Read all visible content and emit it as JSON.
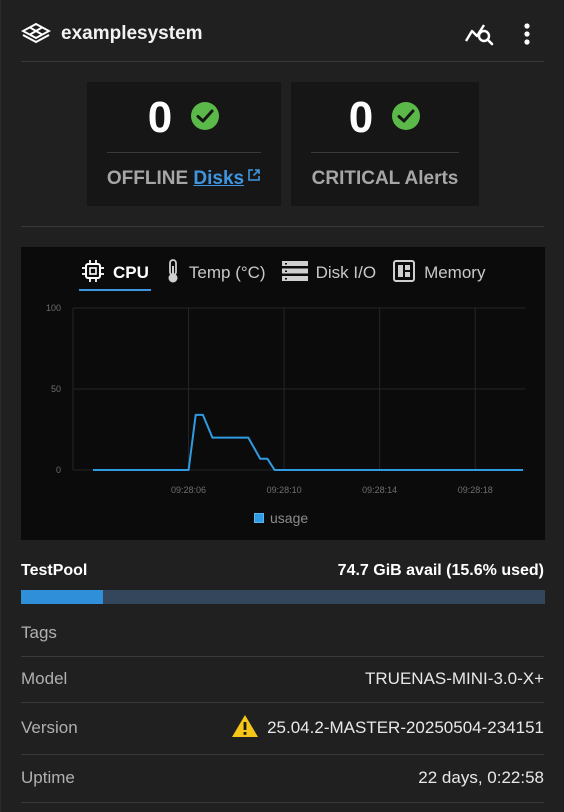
{
  "header": {
    "system_name": "examplesystem",
    "logo_icon": "truenas-logo-icon",
    "reports_icon": "reports-search-icon",
    "menu_icon": "more-vert-icon"
  },
  "tiles": [
    {
      "count": "0",
      "status_icon": "check-circle-icon",
      "label_prefix": "OFFLINE",
      "link_text": "Disks",
      "link_icon": "open-in-new-icon"
    },
    {
      "count": "0",
      "status_icon": "check-circle-icon",
      "label": "CRITICAL Alerts"
    }
  ],
  "chart_tabs": [
    {
      "label": "CPU",
      "icon": "cpu-icon",
      "active": true
    },
    {
      "label": "Temp (°C)",
      "icon": "thermometer-icon",
      "active": false
    },
    {
      "label": "Disk I/O",
      "icon": "disk-icon",
      "active": false
    },
    {
      "label": "Memory",
      "icon": "memory-icon",
      "active": false
    }
  ],
  "chart_data": {
    "type": "line",
    "title": "",
    "xlabel": "",
    "ylabel": "",
    "ylim": [
      0,
      100
    ],
    "yticks": [
      "100",
      "50",
      "0"
    ],
    "xticks": [
      "09:28:06",
      "09:28:10",
      "09:28:14",
      "09:28:18"
    ],
    "x": [
      "09:28:02",
      "09:28:06",
      "09:28:06.3",
      "09:28:06.6",
      "09:28:07",
      "09:28:08",
      "09:28:08.5",
      "09:28:09",
      "09:28:09.3",
      "09:28:09.6",
      "09:28:10",
      "09:28:14",
      "09:28:18",
      "09:28:20"
    ],
    "series": [
      {
        "name": "usage",
        "values": [
          0,
          0,
          34,
          34,
          20,
          20,
          20,
          7,
          7,
          0,
          0,
          0,
          0,
          0
        ]
      }
    ],
    "legend": [
      "usage"
    ],
    "legend_position": "bottom",
    "grid": true,
    "colors": {
      "line": "#2f9be3",
      "grid": "#262626",
      "tick": "#6e6e6e"
    }
  },
  "pool": {
    "name": "TestPool",
    "summary": "74.7 GiB avail (15.6% used)",
    "used_fraction": 0.156
  },
  "info": [
    {
      "key": "Tags",
      "value": ""
    },
    {
      "key": "Model",
      "value": "TRUENAS-MINI-3.0-X+"
    },
    {
      "key": "Version",
      "value": "25.04.2-MASTER-20250504-234151",
      "icon": "warning-icon"
    },
    {
      "key": "Uptime",
      "value": "22 days, 0:22:58"
    }
  ],
  "colors": {
    "accent": "#3e96e0",
    "ok": "#5bb94a",
    "warning": "#f5c518"
  }
}
